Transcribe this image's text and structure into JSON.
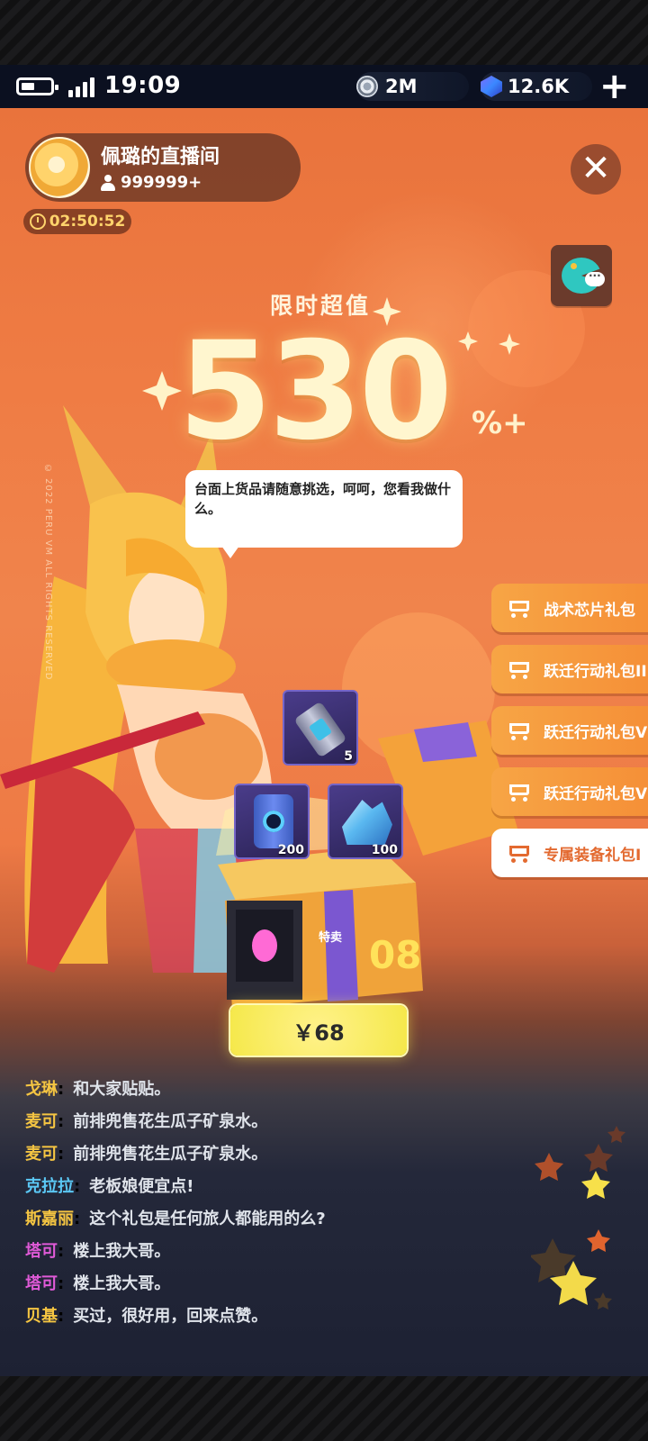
{
  "status_bar": {
    "time": "19:09"
  },
  "currencies": {
    "coins": "2M",
    "gems": "12.6K"
  },
  "host": {
    "name": "佩璐的直播间",
    "viewers": "999999+"
  },
  "timer": "02:50:52",
  "promo": {
    "label": "限时超值",
    "value": "530",
    "suffix": "%+"
  },
  "copyright": "© 2022 PERU VM ALL RIGHTS RESERVED",
  "bubble": "台面上货品请随意挑选，呵呵，您看我做什么。",
  "packs": [
    {
      "label": "战术芯片礼包",
      "selected": false
    },
    {
      "label": "跃迁行动礼包II",
      "selected": false
    },
    {
      "label": "跃迁行动礼包V",
      "selected": false
    },
    {
      "label": "跃迁行动礼包VI",
      "selected": false
    },
    {
      "label": "专属装备礼包I",
      "selected": true
    }
  ],
  "items": [
    {
      "name": "canister",
      "qty": "5"
    },
    {
      "name": "battery",
      "qty": "200"
    },
    {
      "name": "crystal",
      "qty": "100"
    }
  ],
  "box": {
    "tag": "特卖",
    "number": "08"
  },
  "price": "￥68",
  "chat": [
    {
      "name": "戈琳",
      "text": "和大家贴贴。",
      "color": "#f5c542"
    },
    {
      "name": "麦可",
      "text": "前排兜售花生瓜子矿泉水。",
      "color": "#f5c542"
    },
    {
      "name": "麦可",
      "text": "前排兜售花生瓜子矿泉水。",
      "color": "#f5c542"
    },
    {
      "name": "克拉拉",
      "text": "老板娘便宜点!",
      "color": "#5bc8f5"
    },
    {
      "name": "斯嘉丽",
      "text": "这个礼包是任何旅人都能用的么?",
      "color": "#f5c542"
    },
    {
      "name": "塔可",
      "text": "楼上我大哥。",
      "color": "#e05ad8"
    },
    {
      "name": "塔可",
      "text": "楼上我大哥。",
      "color": "#e05ad8"
    },
    {
      "name": "贝基",
      "text": "买过，很好用，回来点赞。",
      "color": "#f5c542"
    }
  ],
  "colors": {
    "accent": "#f58f37",
    "price_button": "#f5e84a",
    "background": "#ee7a45"
  }
}
